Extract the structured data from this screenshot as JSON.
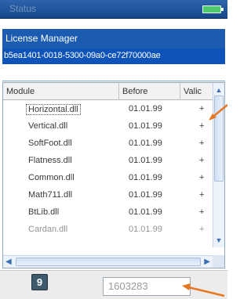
{
  "window": {
    "title": "Status",
    "battery_icon": "battery-icon"
  },
  "license_manager": {
    "title": "License Manager",
    "guid": "b5ea1401-0018-5300-09a0-ce72f70000ae"
  },
  "table": {
    "columns": [
      "Module",
      "Before",
      "Valic"
    ],
    "rows": [
      {
        "module": "Horizontal.dll",
        "before": "01.01.99",
        "valid": "+"
      },
      {
        "module": "Vertical.dll",
        "before": "01.01.99",
        "valid": "+"
      },
      {
        "module": "SoftFoot.dll",
        "before": "01.01.99",
        "valid": "+"
      },
      {
        "module": "Flatness.dll",
        "before": "01.01.99",
        "valid": "+"
      },
      {
        "module": "Common.dll",
        "before": "01.01.99",
        "valid": "+"
      },
      {
        "module": "Math711.dll",
        "before": "01.01.99",
        "valid": "+"
      },
      {
        "module": "BtLib.dll",
        "before": "01.01.99",
        "valid": "+"
      },
      {
        "module": "Cardan.dll",
        "before": "01.01.99",
        "valid": "+"
      }
    ]
  },
  "footer": {
    "number_icon_label": "9",
    "code_value": "1603283"
  },
  "colors": {
    "header_blue": "#1b5cb0",
    "selection_blue": "#0d53b8",
    "annotation_orange": "#e87722"
  }
}
